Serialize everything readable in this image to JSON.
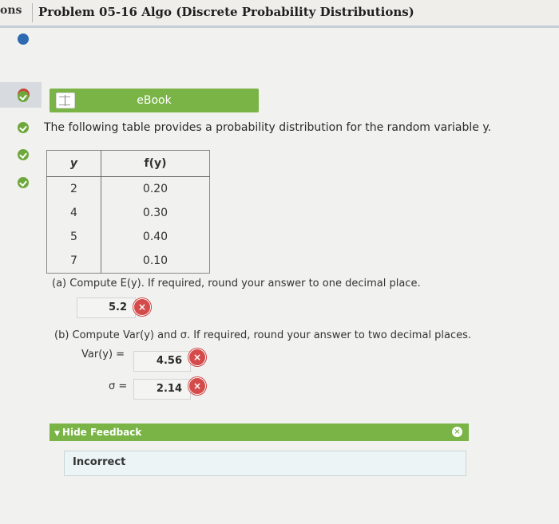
{
  "header": {
    "tab_label": "ons",
    "title": "Problem 05-16 Algo (Discrete Probability Distributions)"
  },
  "ebook": {
    "label": "eBook"
  },
  "intro": "The following table provides a probability distribution for the random variable y.",
  "table": {
    "headers": [
      "y",
      "f(y)"
    ],
    "rows": [
      [
        "2",
        "0.20"
      ],
      [
        "4",
        "0.30"
      ],
      [
        "5",
        "0.40"
      ],
      [
        "7",
        "0.10"
      ]
    ]
  },
  "part_a": {
    "prompt": "(a) Compute E(y). If required, round your answer to one decimal place.",
    "answer": "5.2"
  },
  "part_b": {
    "prompt": "(b) Compute Var(y) and σ. If required, round your answer to two decimal places.",
    "var_label": "Var(y) =",
    "var_answer": "4.56",
    "sigma_label": "σ =",
    "sigma_answer": "2.14"
  },
  "feedback": {
    "toggle_label": "Hide Feedback",
    "message": "Incorrect"
  },
  "colors": {
    "accent_green": "#7ab447",
    "error_red": "#d44b4b",
    "nav_blue": "#2e6ab1"
  }
}
